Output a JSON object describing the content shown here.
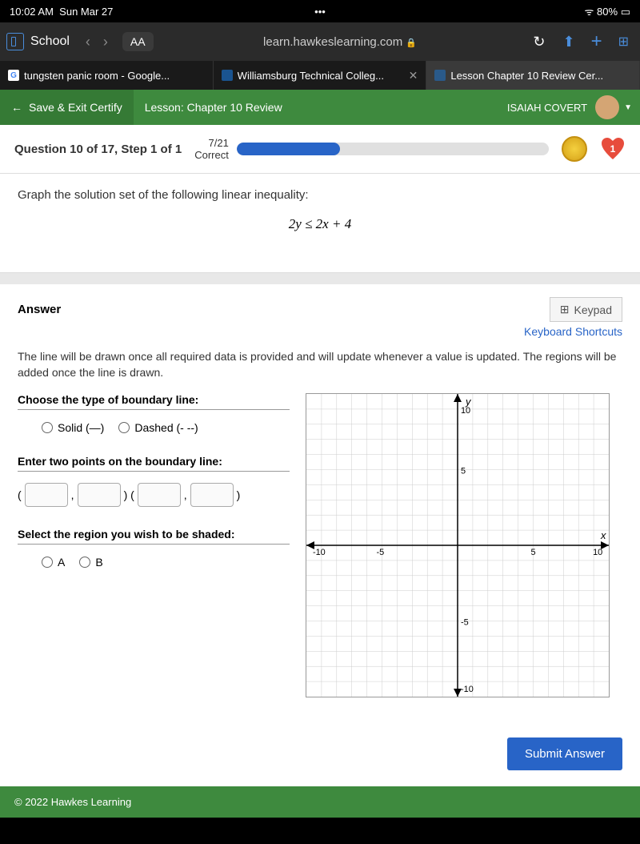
{
  "status": {
    "time": "10:02 AM",
    "date": "Sun Mar 27",
    "battery": "80%"
  },
  "browser": {
    "tab_group": "School",
    "aa": "AA",
    "url": "learn.hawkeslearning.com",
    "tabs": [
      {
        "label": "tungsten panic room - Google..."
      },
      {
        "label": "Williamsburg Technical Colleg..."
      },
      {
        "label": "Lesson Chapter 10 Review Cer..."
      }
    ]
  },
  "header": {
    "save_exit": "Save & Exit Certify",
    "lesson": "Lesson: Chapter 10 Review",
    "user": "ISAIAH COVERT"
  },
  "question": {
    "label": "Question 10 of 17, Step 1 of 1",
    "progress_num": "7/21",
    "progress_word": "Correct",
    "heart_count": "1"
  },
  "prompt": {
    "text": "Graph the solution set of the following linear inequality:",
    "equation": "2y ≤ 2x + 4"
  },
  "answer": {
    "title": "Answer",
    "keypad": "Keypad",
    "shortcuts": "Keyboard Shortcuts",
    "help": "The line will be drawn once all required data is provided and will update whenever a value is updated. The regions will be added once the line is drawn.",
    "boundary_label": "Choose the type of boundary line:",
    "solid": "Solid (—)",
    "dashed": "Dashed (- --)",
    "points_label": "Enter two points on the boundary line:",
    "region_label": "Select the region you wish to be shaded:",
    "region_a": "A",
    "region_b": "B",
    "submit": "Submit Answer"
  },
  "graph": {
    "y_label": "y",
    "x_label": "x",
    "ticks": {
      "neg10": "-10",
      "neg5": "-5",
      "pos5": "5",
      "pos10": "10"
    }
  },
  "footer": {
    "copyright": "© 2022 Hawkes Learning"
  }
}
